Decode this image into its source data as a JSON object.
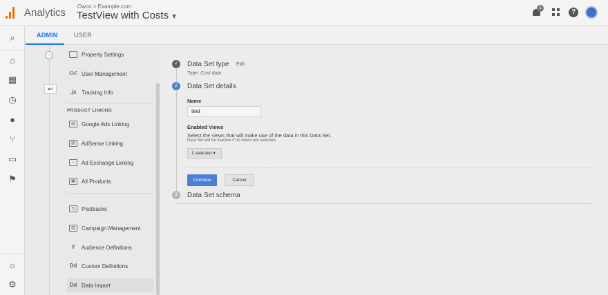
{
  "header": {
    "app_name": "Analytics",
    "breadcrumb": "Owox > Example.com",
    "view_name": "TestView with Costs",
    "notification_count": "1"
  },
  "colors": {
    "accent": "#1a73e8",
    "logo": "#e8710a",
    "button": "#4a7fd6"
  },
  "tabs": {
    "admin": "ADMIN",
    "user": "USER"
  },
  "sidebar": {
    "items": [
      {
        "label": "Property Settings",
        "icon": "property-settings-icon"
      },
      {
        "label": "User Management",
        "icon": "users-icon"
      },
      {
        "label": "Tracking Info",
        "icon": "js-icon"
      }
    ],
    "section_title": "PRODUCT LINKING",
    "linking_items": [
      {
        "label": "Google Ads Linking",
        "icon": "ads-icon"
      },
      {
        "label": "AdSense Linking",
        "icon": "adsense-icon"
      },
      {
        "label": "Ad Exchange Linking",
        "icon": "adexchange-icon"
      },
      {
        "label": "All Products",
        "icon": "all-products-icon"
      }
    ],
    "other_items": [
      {
        "label": "Postbacks",
        "icon": "postbacks-icon"
      },
      {
        "label": "Campaign Management",
        "icon": "campaign-icon"
      },
      {
        "label": "Audience Definitions",
        "icon": "audience-icon"
      },
      {
        "label": "Custom Definitions",
        "icon": "dd-icon"
      },
      {
        "label": "Data Import",
        "icon": "dd-icon"
      }
    ]
  },
  "steps": {
    "step1": {
      "title": "Data Set type",
      "edit": "Edit",
      "type_label": "Type:",
      "type_value": "Cost data"
    },
    "step2": {
      "number": "2",
      "title": "Data Set details",
      "name_label": "Name",
      "name_value": "test",
      "views_label": "Enabled Views",
      "views_desc": "Select the views that will make use of the data in this Data Set.",
      "views_note": "Data Set will be inactive if no views are selected.",
      "views_selected": "1 selected",
      "continue": "Continue",
      "cancel": "Cancel"
    },
    "step3": {
      "number": "3",
      "title": "Data Set schema"
    }
  }
}
